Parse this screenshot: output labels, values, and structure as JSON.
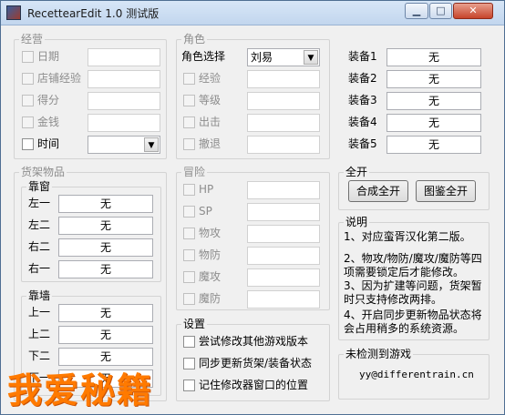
{
  "window": {
    "title": "RecettearEdit 1.0 测试版"
  },
  "business": {
    "legend": "经营",
    "rows": [
      {
        "label": "日期",
        "value": "",
        "enabled": false
      },
      {
        "label": "店铺经验",
        "value": "",
        "enabled": false
      },
      {
        "label": "得分",
        "value": "",
        "enabled": false
      },
      {
        "label": "金钱",
        "value": "",
        "enabled": false
      },
      {
        "label": "时间",
        "value": "",
        "enabled": true,
        "dropdown": true
      }
    ]
  },
  "character": {
    "legend": "角色",
    "select_label": "角色选择",
    "select_value": "刘易",
    "rows": [
      {
        "label": "经验",
        "value": ""
      },
      {
        "label": "等级",
        "value": ""
      },
      {
        "label": "出击",
        "value": ""
      },
      {
        "label": "撤退",
        "value": ""
      }
    ],
    "equipment": [
      {
        "label": "装备1",
        "value": "无"
      },
      {
        "label": "装备2",
        "value": "无"
      },
      {
        "label": "装备3",
        "value": "无"
      },
      {
        "label": "装备4",
        "value": "无"
      },
      {
        "label": "装备5",
        "value": "无"
      }
    ]
  },
  "shelf": {
    "legend": "货架物品",
    "window_group": {
      "legend": "靠窗",
      "rows": [
        {
          "label": "左一",
          "value": "无"
        },
        {
          "label": "左二",
          "value": "无"
        },
        {
          "label": "右二",
          "value": "无"
        },
        {
          "label": "右一",
          "value": "无"
        }
      ]
    },
    "wall_group": {
      "legend": "靠墙",
      "rows": [
        {
          "label": "上一",
          "value": "无"
        },
        {
          "label": "上二",
          "value": "无"
        },
        {
          "label": "下二",
          "value": "无"
        },
        {
          "label": "下一",
          "value": "无"
        }
      ]
    }
  },
  "adventure": {
    "legend": "冒险",
    "rows": [
      {
        "label": "HP",
        "value": ""
      },
      {
        "label": "SP",
        "value": ""
      },
      {
        "label": "物攻",
        "value": ""
      },
      {
        "label": "物防",
        "value": ""
      },
      {
        "label": "魔攻",
        "value": ""
      },
      {
        "label": "魔防",
        "value": ""
      }
    ]
  },
  "unlock": {
    "legend": "全开",
    "craft_button": "合成全开",
    "book_button": "图鉴全开"
  },
  "notes": {
    "legend": "说明",
    "lines": [
      "1、对应蛮胥汉化第二版。",
      "2、物攻/物防/魔攻/魔防等四项需要锁定后才能修改。",
      "3、因为扩建等问题，货架暂时只支持修改两排。",
      "4、开启同步更新物品状态将会占用稍多的系统资源。"
    ]
  },
  "settings": {
    "legend": "设置",
    "options": [
      {
        "label": "尝试修改其他游戏版本",
        "checked": false
      },
      {
        "label": "同步更新货架/装备状态",
        "checked": false
      },
      {
        "label": "记住修改器窗口的位置",
        "checked": false
      }
    ]
  },
  "status": {
    "text": "未检测到游戏",
    "email": "yy@differentrain.cn"
  },
  "watermark": "我爱秘籍"
}
